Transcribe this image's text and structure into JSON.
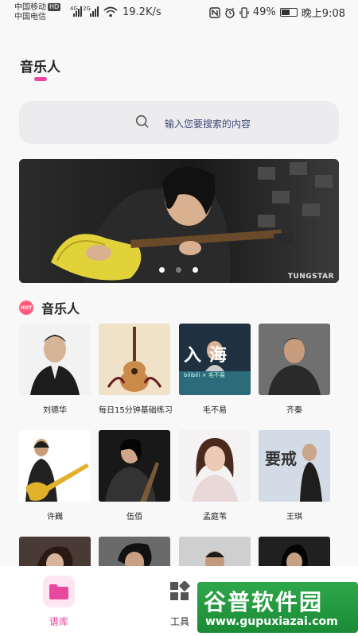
{
  "status_bar": {
    "carrier1": "中国移动",
    "hd_badge": "HD",
    "carrier2": "中国电信",
    "net1": "4G",
    "net2": "2G",
    "speed": "19.2K/s",
    "battery": "49%",
    "battery_level": 0.49,
    "time": "晚上9:08"
  },
  "header": {
    "title": "音乐人"
  },
  "search": {
    "placeholder": "输入您要搜索的内容"
  },
  "banner": {
    "watermark": "TUNGSTAR",
    "active_index": 0,
    "total": 3
  },
  "section": {
    "title": "音乐人",
    "hot_label": "HOT"
  },
  "artists": [
    {
      "name": "刘德华"
    },
    {
      "name": "每日15分钟基础练习"
    },
    {
      "name": "毛不易",
      "thumb_text": "入海",
      "thumb_sub": "bilibili × 毛不易"
    },
    {
      "name": "齐秦"
    },
    {
      "name": "许巍"
    },
    {
      "name": "伍佰"
    },
    {
      "name": "孟庭苇"
    },
    {
      "name": "王琪",
      "thumb_text": "要戒"
    }
  ],
  "tabs": [
    {
      "label": "谱库",
      "active": true
    },
    {
      "label": "工具",
      "active": false
    }
  ],
  "watermark": {
    "main": "谷普软件园",
    "sub": "www.gupuxiazai.com"
  },
  "colors": {
    "accent": "#e8489d",
    "text": "#222222",
    "search_text": "#3d4a78"
  }
}
